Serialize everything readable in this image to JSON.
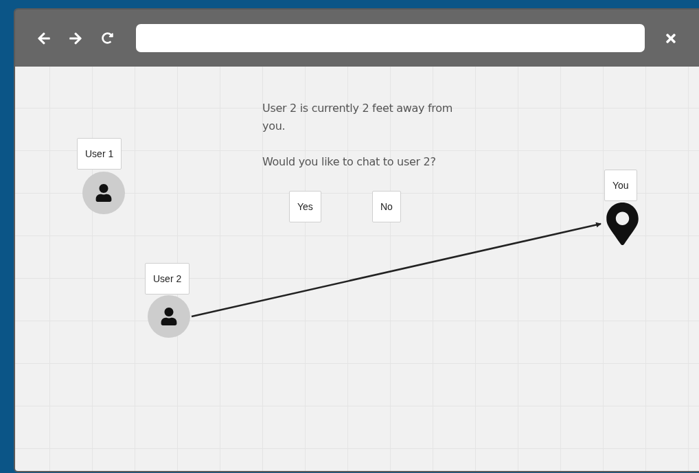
{
  "dialog": {
    "message": "User 2 is currently 2 feet away from you.",
    "question": "Would you like to chat to user 2?",
    "buttons": [
      "Yes",
      "No"
    ]
  },
  "users": [
    {
      "label": "User 1"
    },
    {
      "label": "User 2"
    }
  ],
  "you": {
    "label": "You"
  }
}
